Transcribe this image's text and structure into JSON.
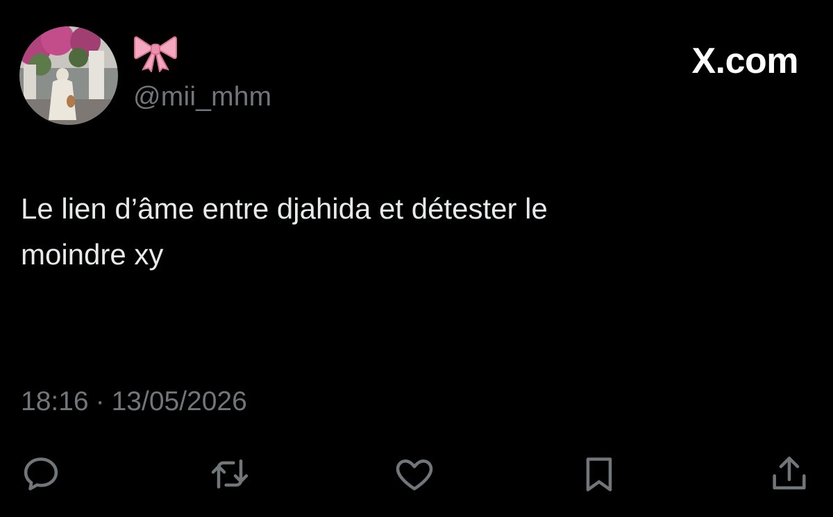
{
  "author": {
    "avatar_icon": "profile-photo",
    "display_name_icon": "pink-ribbon-bow-emoji",
    "handle": "@mii_mhm"
  },
  "brand": {
    "label": "X.com"
  },
  "tweet": {
    "text": "Le lien d’âme entre djahida et détester le\nmoindre xy",
    "time": "18:16",
    "separator": "·",
    "date": "13/05/2026"
  },
  "actions": [
    {
      "name": "reply",
      "icon": "speech-bubble-icon"
    },
    {
      "name": "retweet",
      "icon": "retweet-arrows-icon"
    },
    {
      "name": "like",
      "icon": "heart-icon"
    },
    {
      "name": "bookmark",
      "icon": "bookmark-icon"
    },
    {
      "name": "share",
      "icon": "share-upload-icon"
    }
  ],
  "colors": {
    "background": "#000000",
    "text_primary": "#e7e9ea",
    "text_secondary": "#71767b",
    "ribbon": "#f4a7c0"
  }
}
